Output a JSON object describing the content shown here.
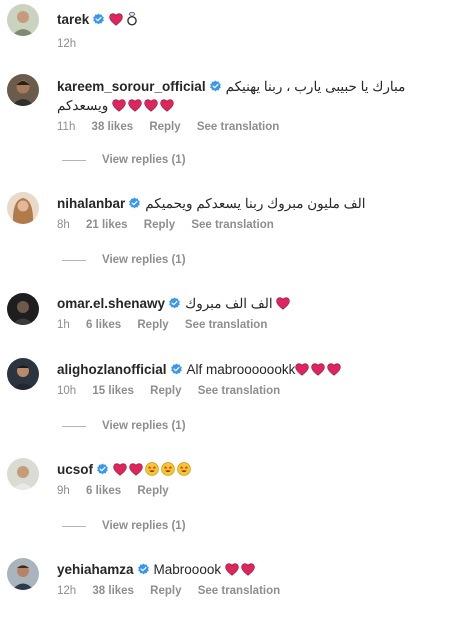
{
  "comments": [
    {
      "username": "tarek",
      "verified": true,
      "text": "",
      "time": "12h",
      "likes": "",
      "reply": "",
      "see_translation": "",
      "emojis": [
        "red-heart",
        "diamond-ring"
      ]
    },
    {
      "username": "kareem_sorour_official",
      "verified": true,
      "text": "مبارك يا حبيبى يارب ، ربنا يهنيكم",
      "text2": "ويسعدكم",
      "time": "11h",
      "likes": "38 likes",
      "reply": "Reply",
      "see_translation": "See translation",
      "emojis": [
        "red-heart",
        "red-heart",
        "red-heart",
        "red-heart"
      ],
      "view_replies": "View replies (1)"
    },
    {
      "username": "nihalanbar",
      "verified": true,
      "text": "الف مليون مبروك ربنا يسعدكم ويحميكم",
      "time": "8h",
      "likes": "21 likes",
      "reply": "Reply",
      "see_translation": "See translation",
      "view_replies": "View replies (1)"
    },
    {
      "username": "omar.el.shenawy",
      "verified": true,
      "text": "الف الف مبروك",
      "time": "1h",
      "likes": "6 likes",
      "reply": "Reply",
      "see_translation": "See translation",
      "emojis": [
        "red-heart"
      ]
    },
    {
      "username": "alighozlanofficial",
      "verified": true,
      "text": "Alf mabrooooookk",
      "time": "10h",
      "likes": "15 likes",
      "reply": "Reply",
      "see_translation": "See translation",
      "emojis": [
        "red-heart",
        "red-heart",
        "red-heart"
      ],
      "view_replies": "View replies (1)"
    },
    {
      "username": "ucsof",
      "verified": true,
      "text": "",
      "time": "9h",
      "likes": "6 likes",
      "reply": "Reply",
      "emojis": [
        "red-heart",
        "red-heart",
        "star-struck",
        "star-struck",
        "star-struck"
      ],
      "view_replies": "View replies (1)"
    },
    {
      "username": "yehiahamza",
      "verified": true,
      "text": "Mabrooook",
      "time": "12h",
      "likes": "38 likes",
      "reply": "Reply",
      "see_translation": "See translation",
      "emojis": [
        "red-heart",
        "red-heart"
      ]
    }
  ],
  "colors": {
    "verified_blue": "#3897f0",
    "heart_red": "#e0245e",
    "meta_gray": "#8e8e8e",
    "text": "#262626"
  }
}
